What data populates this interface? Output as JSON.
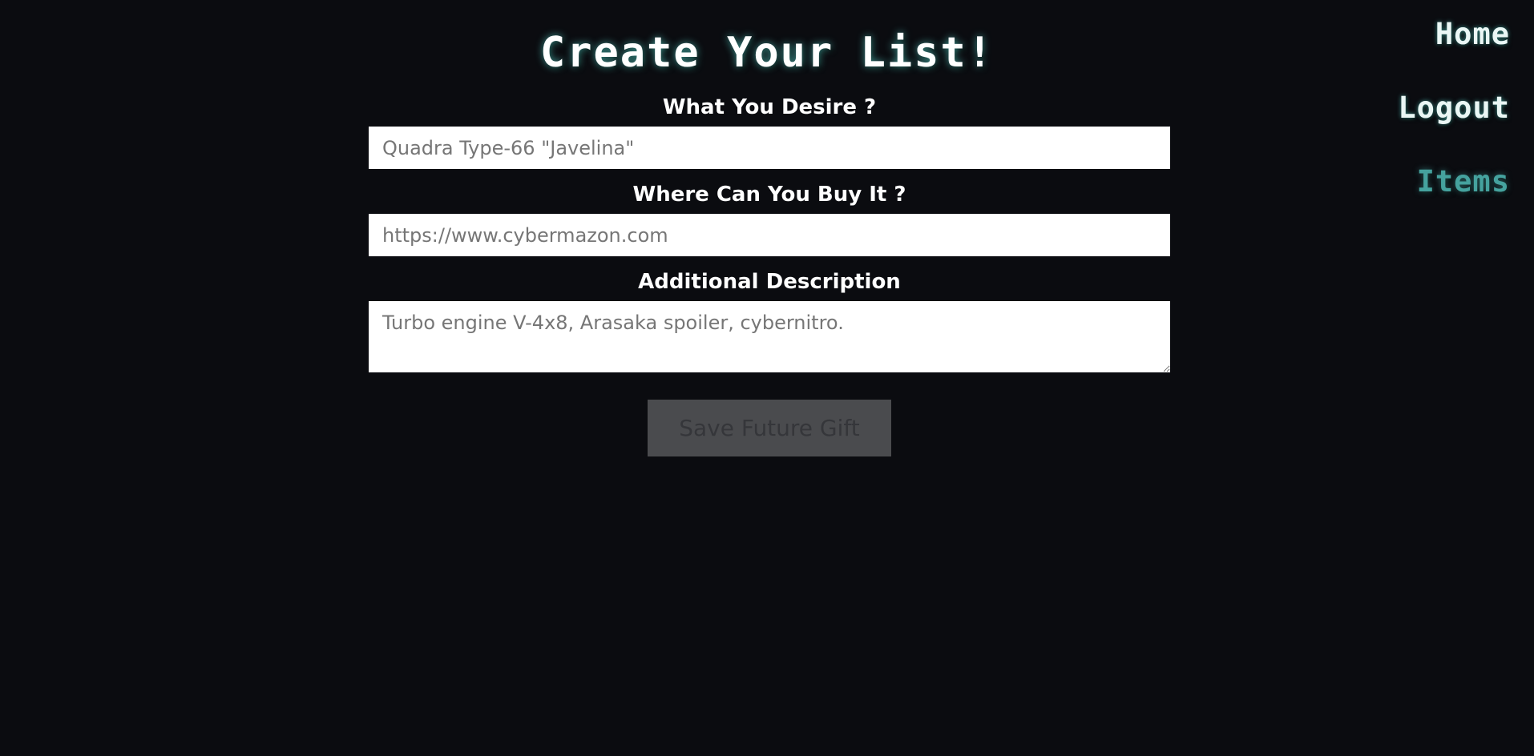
{
  "nav": {
    "items": [
      {
        "label": "Home"
      },
      {
        "label": "Logout"
      },
      {
        "label": "Items"
      }
    ]
  },
  "form": {
    "title": "Create Your List!",
    "desire_label": "What You Desire ?",
    "desire_placeholder": "Quadra Type-66 \"Javelina\"",
    "where_label": "Where Can You Buy It ?",
    "where_placeholder": "https://www.cybermazon.com",
    "description_label": "Additional Description",
    "description_placeholder": "Turbo engine V-4x8, Arasaka spoiler, cybernitro.",
    "save_label": "Save Future Gift"
  },
  "colors": {
    "background": "#0b0c10",
    "accent": "#45a29e",
    "glow": "#66fcf1",
    "button_bg": "#4a4b4e"
  }
}
